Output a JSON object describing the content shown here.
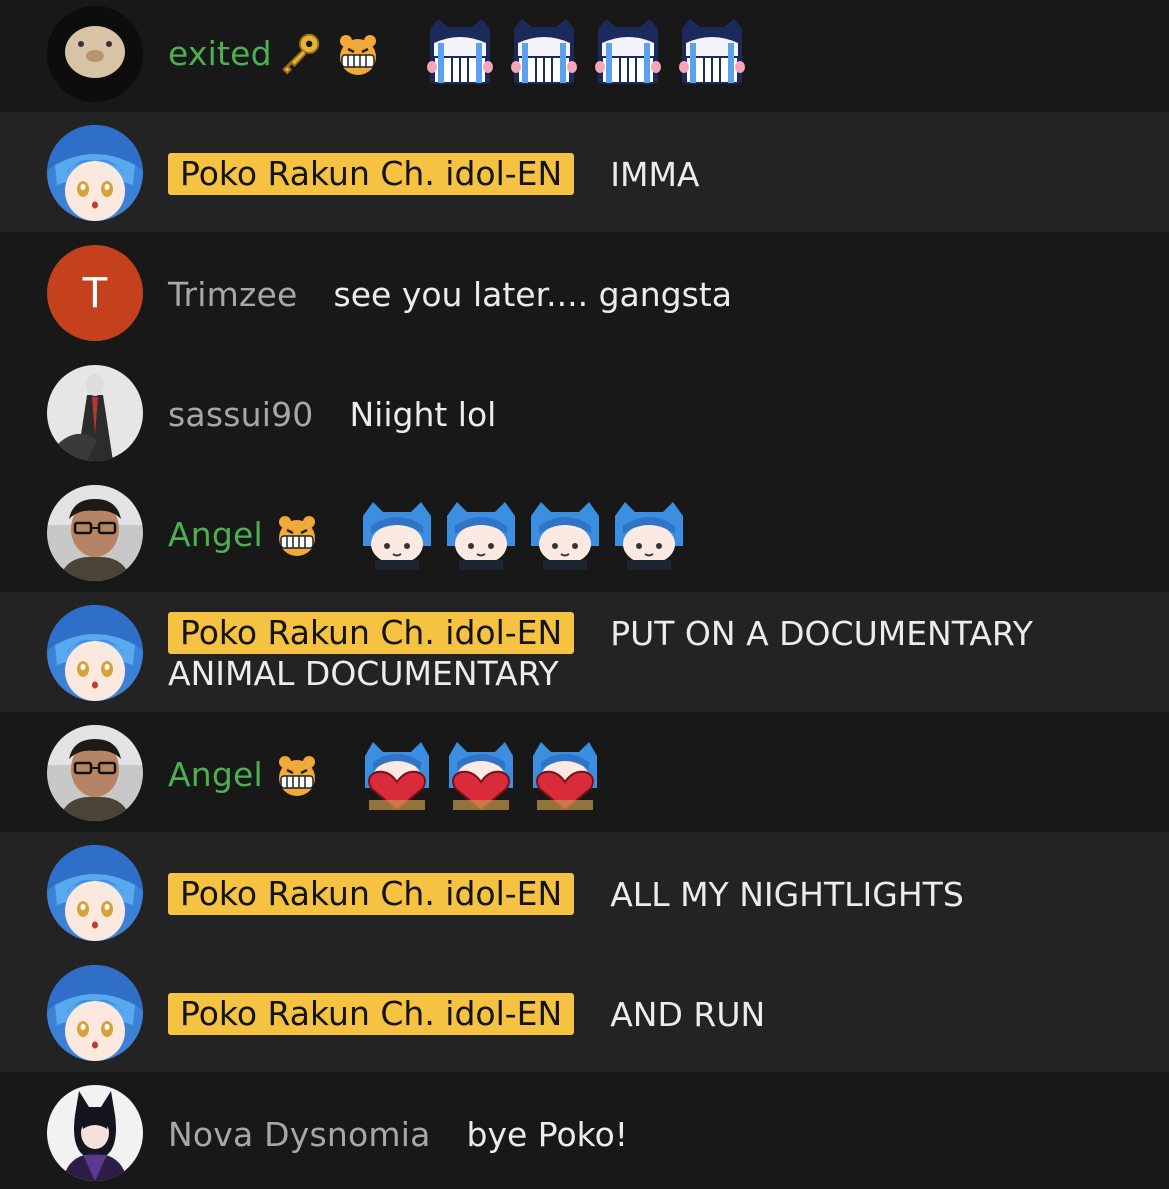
{
  "messages": [
    {
      "author": "exited",
      "badges": [
        "key-icon",
        "member-badge-icon"
      ],
      "text": "",
      "emotes": [
        "crying-emote",
        "crying-emote",
        "crying-emote",
        "crying-emote"
      ]
    },
    {
      "author": "Poko Rakun Ch. idol-EN",
      "owner": true,
      "text": "IMMA"
    },
    {
      "author": "Trimzee",
      "avatar_letter": "T",
      "text": "see you later.... gangsta"
    },
    {
      "author": "sassui90",
      "text": "Niight lol"
    },
    {
      "author": "Angel",
      "badges": [
        "member-badge-icon"
      ],
      "text": "",
      "emotes": [
        "poko-emote",
        "poko-emote",
        "poko-emote",
        "poko-emote"
      ]
    },
    {
      "author": "Poko Rakun Ch. idol-EN",
      "owner": true,
      "text": "PUT ON A DOCUMENTARY",
      "text2": "ANIMAL DOCUMENTARY"
    },
    {
      "author": "Angel",
      "badges": [
        "member-badge-icon"
      ],
      "text": "",
      "emotes": [
        "heart-emote",
        "heart-emote",
        "heart-emote"
      ]
    },
    {
      "author": "Poko Rakun Ch. idol-EN",
      "owner": true,
      "text": "ALL MY NIGHTLIGHTS"
    },
    {
      "author": "Poko Rakun Ch. idol-EN",
      "owner": true,
      "text": "AND RUN"
    },
    {
      "author": "Nova Dysnomia",
      "text": "bye Poko!"
    }
  ],
  "colors": {
    "owner_badge": "#f5c242",
    "member_name": "#4caf50",
    "regular_name": "#a7a7a7",
    "trimzee_avatar": "#c5401d"
  }
}
